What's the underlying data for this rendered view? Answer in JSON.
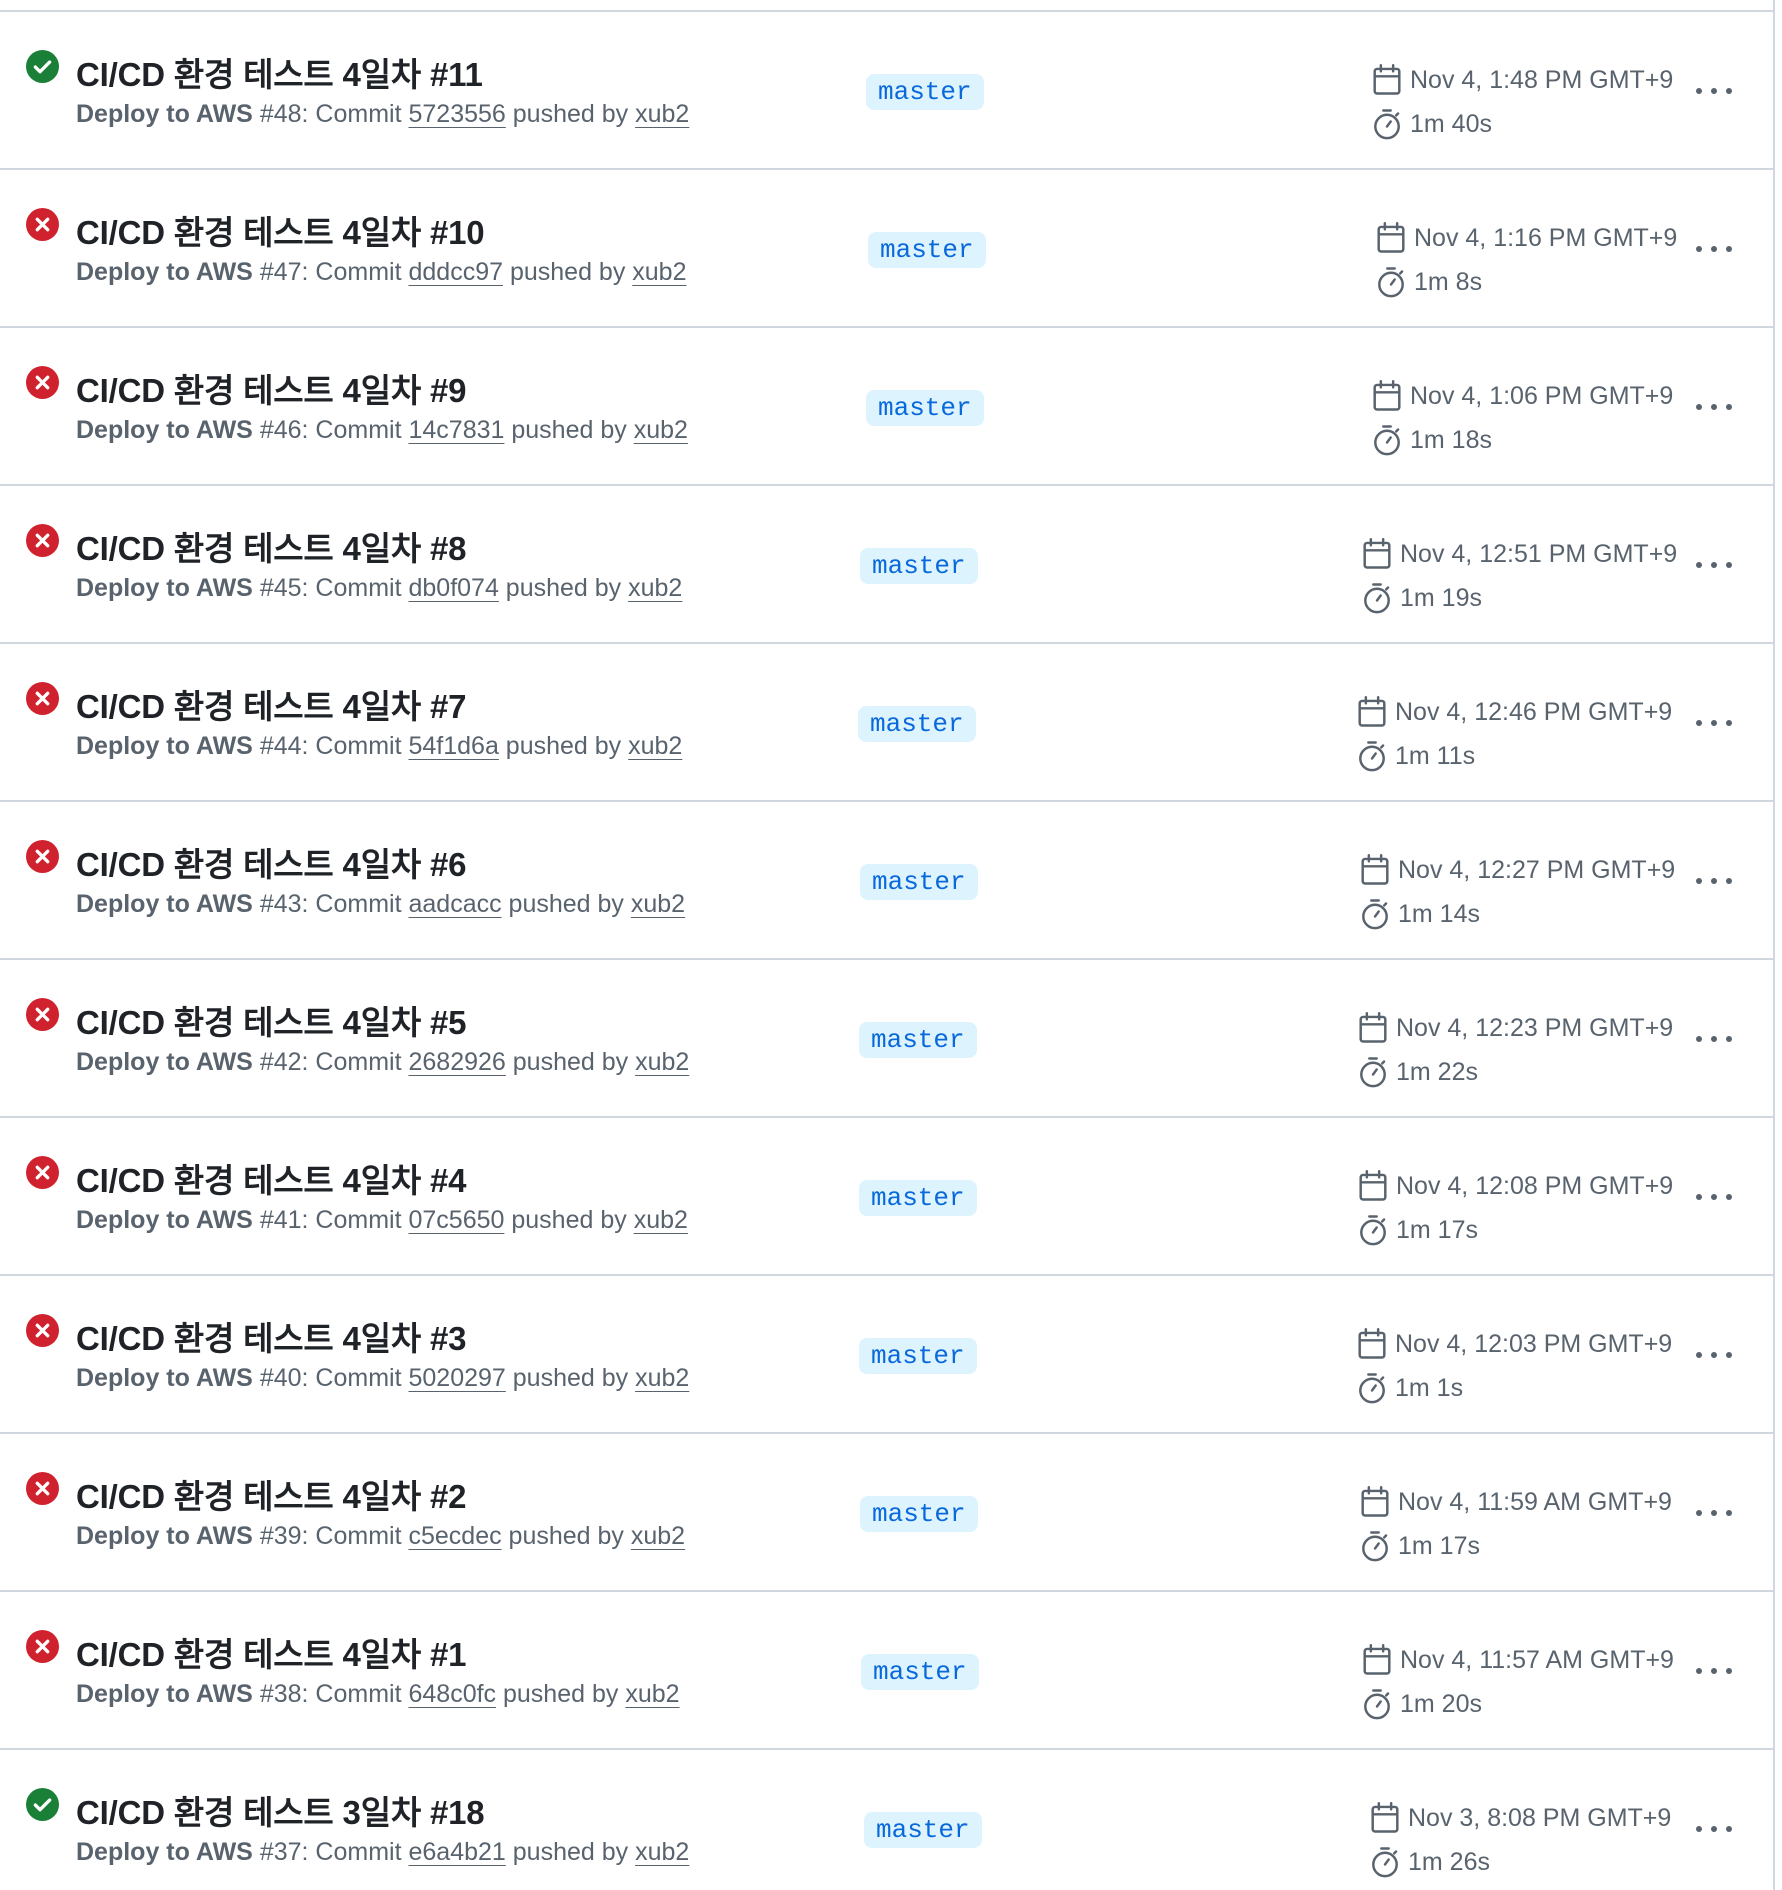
{
  "colors": {
    "success": "#1a7f37",
    "failure": "#cf222e",
    "branch_bg": "#ddf4ff",
    "branch_fg": "#0969da",
    "muted": "#59636e",
    "border": "#d0d7de"
  },
  "runs": [
    {
      "status": "success",
      "status_icon": "check-circle-icon",
      "title": "CI/CD 환경 테스트 4일차 #11",
      "workflow": "Deploy to AWS",
      "run_number": "#48",
      "commit_prefix": ": Commit ",
      "commit": "5723556",
      "pushed_by": " pushed by ",
      "actor": "xub2",
      "branch": "master",
      "date": "Nov 4, 1:48 PM GMT+9",
      "duration": "1m 40s"
    },
    {
      "status": "failure",
      "status_icon": "x-circle-icon",
      "title": "CI/CD 환경 테스트 4일차 #10",
      "workflow": "Deploy to AWS",
      "run_number": "#47",
      "commit_prefix": ": Commit ",
      "commit": "dddcc97",
      "pushed_by": " pushed by ",
      "actor": "xub2",
      "branch": "master",
      "date": "Nov 4, 1:16 PM GMT+9",
      "duration": "1m 8s"
    },
    {
      "status": "failure",
      "status_icon": "x-circle-icon",
      "title": "CI/CD 환경 테스트 4일차 #9",
      "workflow": "Deploy to AWS",
      "run_number": "#46",
      "commit_prefix": ": Commit ",
      "commit": "14c7831",
      "pushed_by": " pushed by ",
      "actor": "xub2",
      "branch": "master",
      "date": "Nov 4, 1:06 PM GMT+9",
      "duration": "1m 18s"
    },
    {
      "status": "failure",
      "status_icon": "x-circle-icon",
      "title": "CI/CD 환경 테스트 4일차 #8",
      "workflow": "Deploy to AWS",
      "run_number": "#45",
      "commit_prefix": ": Commit ",
      "commit": "db0f074",
      "pushed_by": " pushed by ",
      "actor": "xub2",
      "branch": "master",
      "date": "Nov 4, 12:51 PM GMT+9",
      "duration": "1m 19s"
    },
    {
      "status": "failure",
      "status_icon": "x-circle-icon",
      "title": "CI/CD 환경 테스트 4일차 #7",
      "workflow": "Deploy to AWS",
      "run_number": "#44",
      "commit_prefix": ": Commit ",
      "commit": "54f1d6a",
      "pushed_by": " pushed by ",
      "actor": "xub2",
      "branch": "master",
      "date": "Nov 4, 12:46 PM GMT+9",
      "duration": "1m 11s"
    },
    {
      "status": "failure",
      "status_icon": "x-circle-icon",
      "title": "CI/CD 환경 테스트 4일차 #6",
      "workflow": "Deploy to AWS",
      "run_number": "#43",
      "commit_prefix": ": Commit ",
      "commit": "aadcacc",
      "pushed_by": " pushed by ",
      "actor": "xub2",
      "branch": "master",
      "date": "Nov 4, 12:27 PM GMT+9",
      "duration": "1m 14s"
    },
    {
      "status": "failure",
      "status_icon": "x-circle-icon",
      "title": "CI/CD 환경 테스트 4일차 #5",
      "workflow": "Deploy to AWS",
      "run_number": "#42",
      "commit_prefix": ": Commit ",
      "commit": "2682926",
      "pushed_by": " pushed by ",
      "actor": "xub2",
      "branch": "master",
      "date": "Nov 4, 12:23 PM GMT+9",
      "duration": "1m 22s"
    },
    {
      "status": "failure",
      "status_icon": "x-circle-icon",
      "title": "CI/CD 환경 테스트 4일차 #4",
      "workflow": "Deploy to AWS",
      "run_number": "#41",
      "commit_prefix": ": Commit ",
      "commit": "07c5650",
      "pushed_by": " pushed by ",
      "actor": "xub2",
      "branch": "master",
      "date": "Nov 4, 12:08 PM GMT+9",
      "duration": "1m 17s"
    },
    {
      "status": "failure",
      "status_icon": "x-circle-icon",
      "title": "CI/CD 환경 테스트 4일차 #3",
      "workflow": "Deploy to AWS",
      "run_number": "#40",
      "commit_prefix": ": Commit ",
      "commit": "5020297",
      "pushed_by": " pushed by ",
      "actor": "xub2",
      "branch": "master",
      "date": "Nov 4, 12:03 PM GMT+9",
      "duration": "1m 1s"
    },
    {
      "status": "failure",
      "status_icon": "x-circle-icon",
      "title": "CI/CD 환경 테스트 4일차 #2",
      "workflow": "Deploy to AWS",
      "run_number": "#39",
      "commit_prefix": ": Commit ",
      "commit": "c5ecdec",
      "pushed_by": " pushed by ",
      "actor": "xub2",
      "branch": "master",
      "date": "Nov 4, 11:59 AM GMT+9",
      "duration": "1m 17s"
    },
    {
      "status": "failure",
      "status_icon": "x-circle-icon",
      "title": "CI/CD 환경 테스트 4일차 #1",
      "workflow": "Deploy to AWS",
      "run_number": "#38",
      "commit_prefix": ": Commit ",
      "commit": "648c0fc",
      "pushed_by": " pushed by ",
      "actor": "xub2",
      "branch": "master",
      "date": "Nov 4, 11:57 AM GMT+9",
      "duration": "1m 20s"
    },
    {
      "status": "success",
      "status_icon": "check-circle-icon",
      "title": "CI/CD 환경 테스트 3일차 #18",
      "workflow": "Deploy to AWS",
      "run_number": "#37",
      "commit_prefix": ": Commit ",
      "commit": "e6a4b21",
      "pushed_by": " pushed by ",
      "actor": "xub2",
      "branch": "master",
      "date": "Nov 3, 8:08 PM GMT+9",
      "duration": "1m 26s"
    }
  ]
}
